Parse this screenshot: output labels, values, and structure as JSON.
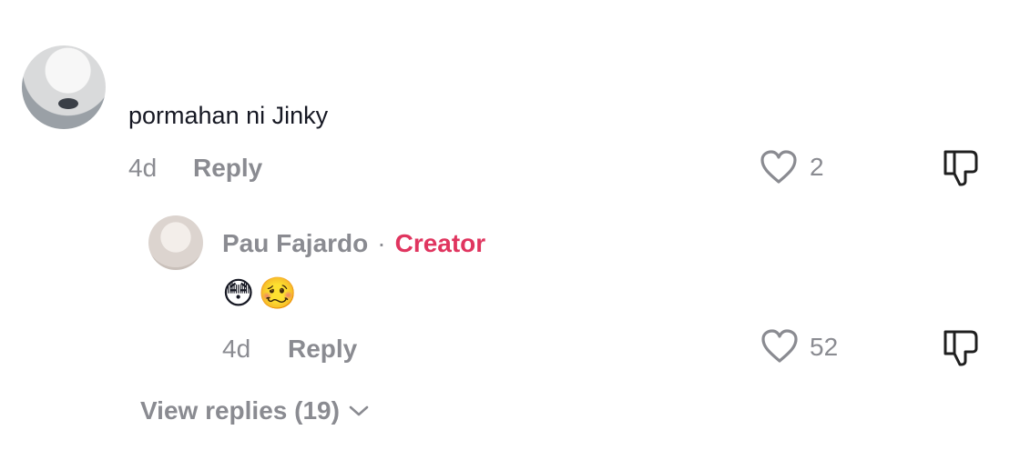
{
  "colors": {
    "accent": "#fe2c55",
    "muted": "#8a8b91",
    "text": "#161823"
  },
  "comment": {
    "text": "pormahan ni Jinky",
    "age": "4d",
    "reply_label": "Reply",
    "likes": "2",
    "like_icon": "heart-icon",
    "dislike_icon": "thumbs-down-icon"
  },
  "reply": {
    "username": "Pau Fajardo",
    "separator": "·",
    "badge": "Creator",
    "emojis": [
      "😳",
      "🥴"
    ],
    "age": "4d",
    "reply_label": "Reply",
    "likes": "52",
    "like_icon": "heart-icon",
    "dislike_icon": "thumbs-down-icon"
  },
  "view_replies": {
    "label": "View replies (19)",
    "icon": "chevron-down-icon"
  }
}
